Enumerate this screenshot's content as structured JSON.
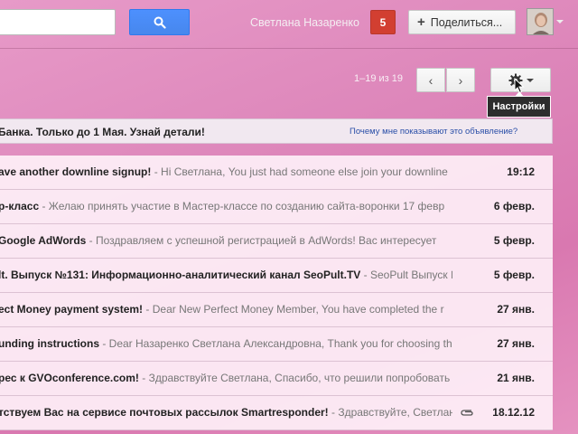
{
  "search": {
    "value": "",
    "placeholder": ""
  },
  "header": {
    "user_name": "Светлана Назаренко",
    "notifications": "5",
    "share_label": "Поделиться...",
    "share_plus": "+"
  },
  "toolbar": {
    "pagination": "1–19 из 19",
    "prev_glyph": "‹",
    "next_glyph": "›",
    "tooltip": "Настройки"
  },
  "ad": {
    "text": "Банка. Только до 1 Мая. Узнай детали!",
    "why": "Почему мне показывают это объявление?"
  },
  "emails": [
    {
      "subject": "ave another downline signup!",
      "snippet": " - Hi Светлана, You just had someone else join your downline",
      "date": "19:12",
      "attachment": false
    },
    {
      "subject": "р-класс",
      "snippet": " - Желаю принять участие в Мастер-классе по созданию сайта-воронки 17 февр",
      "date": "6 февр.",
      "attachment": false
    },
    {
      "subject": "Google AdWords",
      "snippet": " - Поздравляем с успешной регистрацией в AdWords! Вас интересует",
      "date": "5 февр.",
      "attachment": false
    },
    {
      "subject": "lt. Выпуск №131: Информационно-аналитический канал SeoPult.TV",
      "snippet": " - SeoPult Выпуск №",
      "date": "5 февр.",
      "attachment": false
    },
    {
      "subject": "ect Money payment system!",
      "snippet": " - Dear New Perfect Money Member, You have completed the r",
      "date": "27 янв.",
      "attachment": false
    },
    {
      "subject": "unding instructions",
      "snippet": " - Dear Назаренко Светлана Александровна, Thank you for choosing th",
      "date": "27 янв.",
      "attachment": false
    },
    {
      "subject": "рес к GVOconference.com!",
      "snippet": " - Здравствуйте Светлана, Спасибо, что решили попробовать",
      "date": "21 янв.",
      "attachment": false
    },
    {
      "subject": "тствуем Вас на сервисе почтовых рассылок Smartresponder!",
      "snippet": " - Здравствуйте, Светлана",
      "date": "18.12.12",
      "attachment": true
    }
  ],
  "colors": {
    "background": "#e08cbc",
    "search_button": "#4d90fe",
    "badge": "#d23f31",
    "link": "#2a4fa8"
  },
  "icons": {
    "search": "search-icon",
    "settings": "gear-icon",
    "attachment": "paperclip-icon",
    "cursor": "mouse-pointer-icon"
  }
}
